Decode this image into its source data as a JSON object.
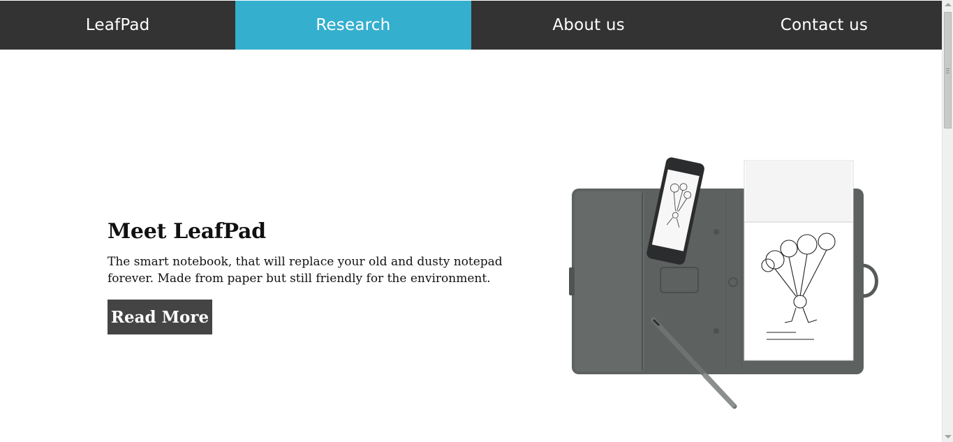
{
  "nav": {
    "items": [
      {
        "label": "LeafPad",
        "active": false
      },
      {
        "label": "Research",
        "active": true
      },
      {
        "label": "About us",
        "active": false
      },
      {
        "label": "Contact us",
        "active": false
      }
    ]
  },
  "hero": {
    "title": "Meet LeafPad",
    "description": "The smart notebook, that will replace your old and dusty notepad forever. Made from paper but still friendly for the environment.",
    "button_label": "Read More",
    "image_icon": "smart-notebook-product-image"
  },
  "colors": {
    "nav_bg": "#333333",
    "nav_active": "#35afce",
    "button_bg": "#444444",
    "folio": "#5d6260"
  }
}
